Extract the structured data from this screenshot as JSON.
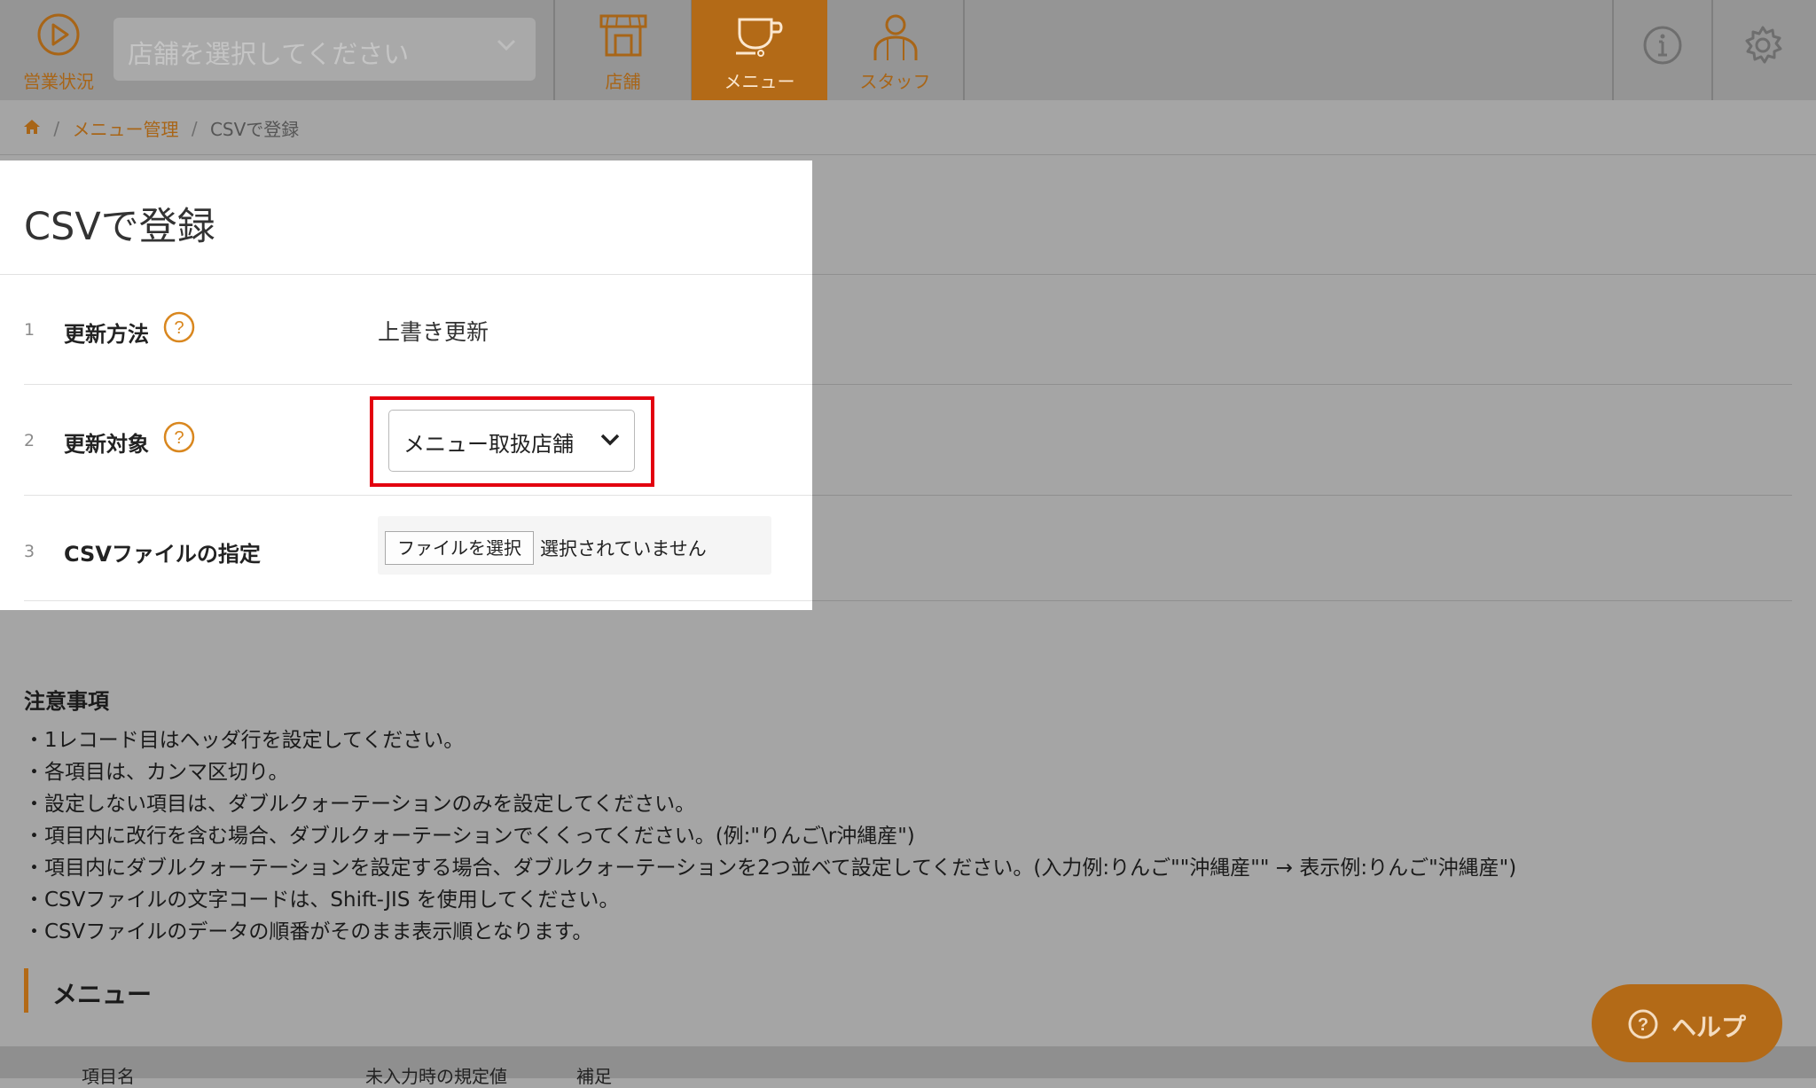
{
  "header": {
    "status_label": "営業状況",
    "store_select_placeholder": "店舗を選択してください",
    "tabs": [
      {
        "label": "店舗",
        "icon": "store-icon",
        "active": false
      },
      {
        "label": "メニュー",
        "icon": "cup-icon",
        "active": true
      },
      {
        "label": "スタッフ",
        "icon": "staff-icon",
        "active": false
      }
    ],
    "info_icon": "info-icon",
    "settings_icon": "gear-icon"
  },
  "breadcrumb": {
    "home_icon": "home-icon",
    "items": [
      "メニュー管理",
      "CSVで登録"
    ]
  },
  "page": {
    "title": "CSVで登録"
  },
  "form": {
    "rows": [
      {
        "num": "1",
        "label": "更新方法",
        "value": "上書き更新"
      },
      {
        "num": "2",
        "label": "更新対象",
        "value": "メニュー取扱店舗"
      },
      {
        "num": "3",
        "label": "CSVファイルの指定",
        "button": "ファイルを選択",
        "status": "選択されていません"
      }
    ]
  },
  "notes": {
    "title": "注意事項",
    "items": [
      "・1レコード目はヘッダ行を設定してください。",
      "・各項目は、カンマ区切り。",
      "・設定しない項目は、ダブルクォーテーションのみを設定してください。",
      "・項目内に改行を含む場合、ダブルクォーテーションでくくってください。(例:\"りんご\\r沖縄産\")",
      "・項目内にダブルクォーテーションを設定する場合、ダブルクォーテーションを2つ並べて設定してください。(入力例:りんご\"\"沖縄産\"\" → 表示例:りんご\"沖縄産\")",
      "・CSVファイルの文字コードは、Shift-JIS を使用してください。",
      "・CSVファイルのデータの順番がそのまま表示順となります。"
    ]
  },
  "menu_section": {
    "heading": "メニュー",
    "columns": [
      "項目名",
      "未入力時の規定値",
      "補足"
    ]
  },
  "help_button": {
    "label": "ヘルプ"
  },
  "colors": {
    "accent": "#b36a17",
    "overlay": "#a5a5a5",
    "highlight": "#e3000f"
  }
}
